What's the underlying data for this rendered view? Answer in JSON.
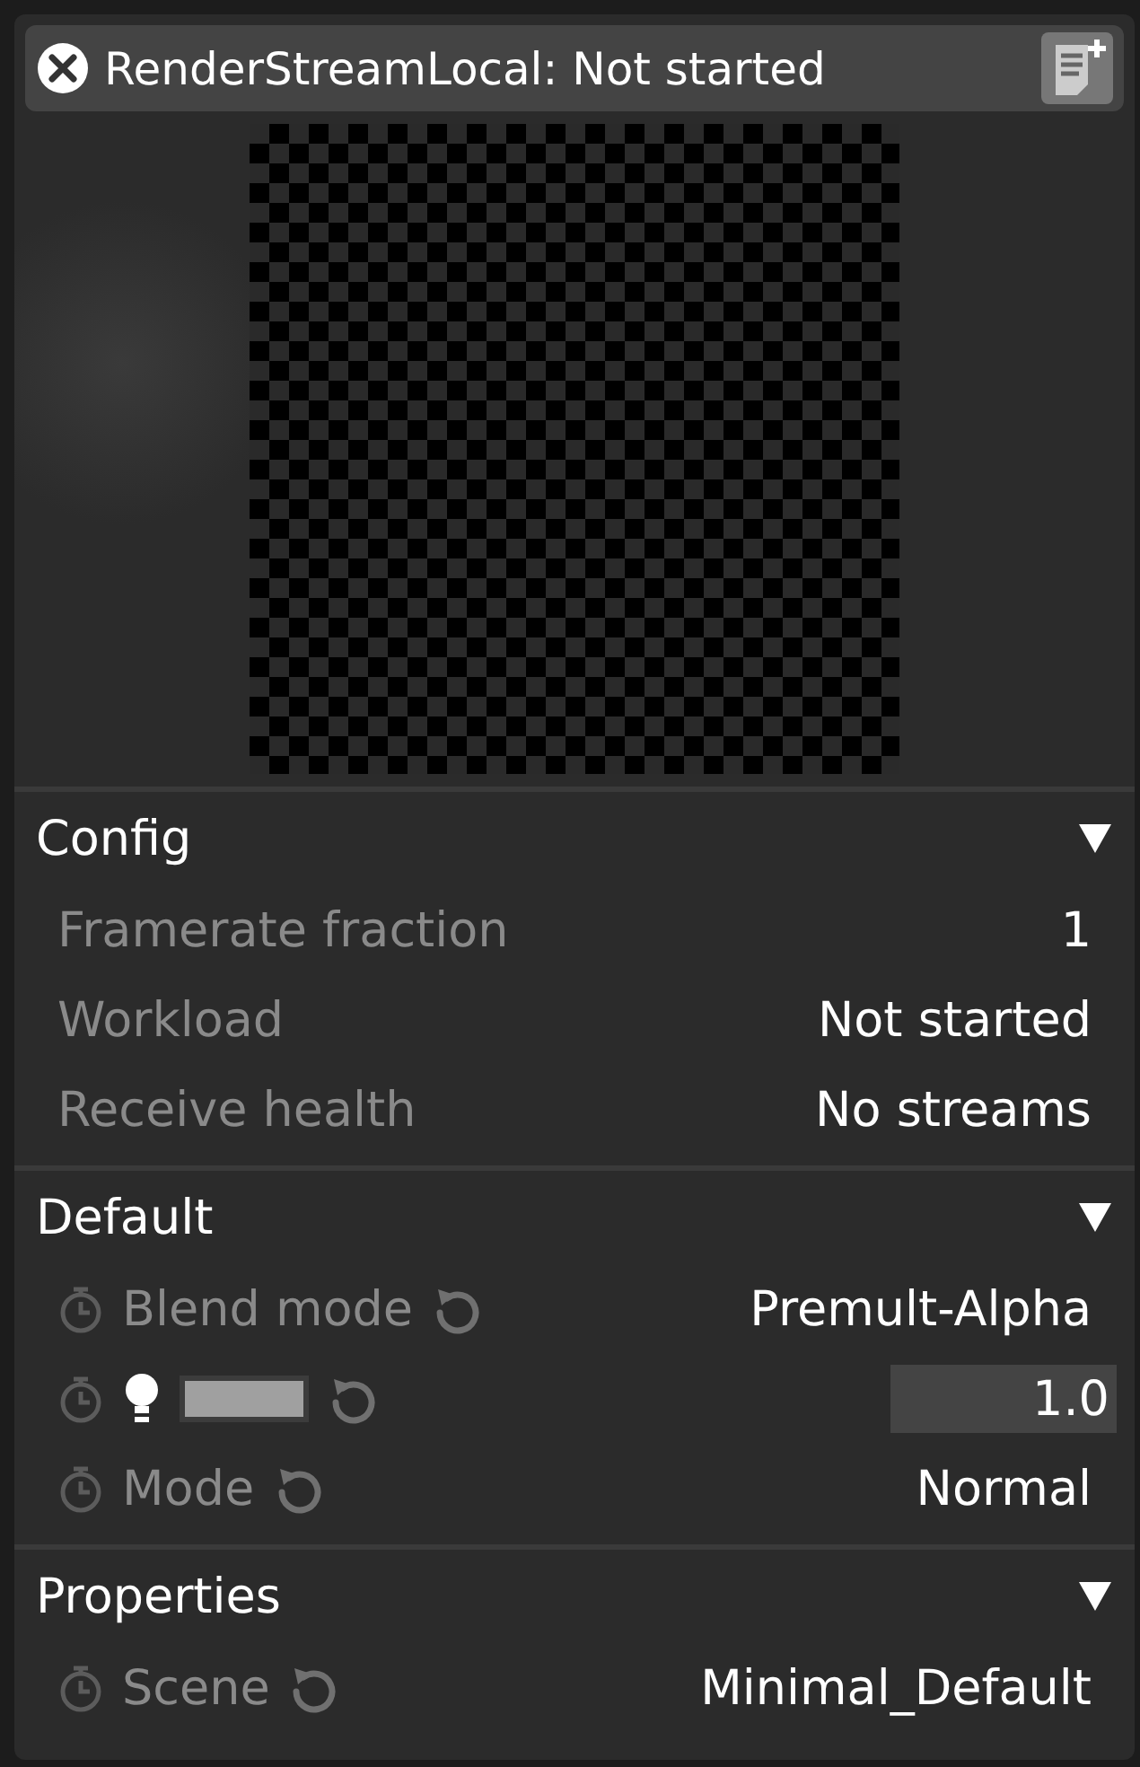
{
  "window": {
    "title": "RenderStreamLocal: Not started"
  },
  "sections": [
    {
      "title": "Config",
      "expanded": true,
      "rows": [
        {
          "kind": "plain",
          "label": "Framerate fraction",
          "value": "1"
        },
        {
          "kind": "plain",
          "label": "Workload",
          "value": "Not started"
        },
        {
          "kind": "plain",
          "label": "Receive health",
          "value": "No streams"
        }
      ]
    },
    {
      "title": "Default",
      "expanded": true,
      "rows": [
        {
          "kind": "param",
          "label": "Blend mode",
          "value": "Premult-Alpha"
        },
        {
          "kind": "colour",
          "value": "1.0"
        },
        {
          "kind": "param",
          "label": "Mode",
          "value": "Normal"
        }
      ]
    },
    {
      "title": "Properties",
      "expanded": true,
      "rows": [
        {
          "kind": "param",
          "label": "Scene",
          "value": "Minimal_Default"
        }
      ]
    }
  ]
}
